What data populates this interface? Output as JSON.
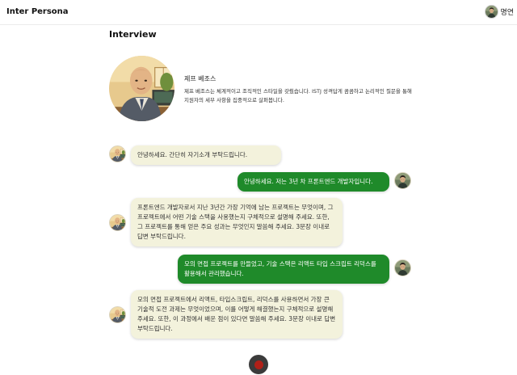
{
  "app": {
    "title": "Inter Persona"
  },
  "user": {
    "name": "명연"
  },
  "page": {
    "title": "Interview"
  },
  "persona": {
    "name": "제프 베조스",
    "description": "제프 베조스는 체계적이고 조직적인 스타일을 갖췄습니다. ISTJ 성격답게 꼼꼼하고 논리적인 질문을 통해 지원자의 세부 사항을 집중적으로 살펴봅니다."
  },
  "messages": [
    {
      "role": "interviewer",
      "text": "안녕하세요. 간단히 자기소개 부탁드립니다."
    },
    {
      "role": "user",
      "text": "안녕하세요. 저는 3년 차 프론트엔드 개발자입니다."
    },
    {
      "role": "interviewer",
      "text": "프론트엔드 개발자로서 지난 3년간 가장 기억에 남는 프로젝트는 무엇이며, 그 프로젝트에서 어떤 기술 스택을 사용했는지 구체적으로 설명해 주세요. 또한, 그 프로젝트를 통해 얻은 주요 성과는 무엇인지 말씀해 주세요. 3문장 이내로 답변 부탁드립니다."
    },
    {
      "role": "user",
      "text": "모의 면접 프로젝트를 만들었고, 기술 스택은 리액트 타입 스크립트 리덕스를 활용해서 관리했습니다."
    },
    {
      "role": "interviewer",
      "text": "모의 면접 프로젝트에서 리액트, 타입스크립트, 리덕스를 사용하면서 가장 큰 기술적 도전 과제는 무엇이었으며, 이를 어떻게 해결했는지 구체적으로 설명해 주세요. 또한, 이 과정에서 배운 점이 있다면 말씀해 주세요. 3문장 이내로 답변 부탁드립니다."
    }
  ],
  "controls": {
    "record_icon": "record-icon"
  },
  "colors": {
    "user_bubble": "#1f8a2a",
    "bot_bubble": "#f3f2dc",
    "record": "#b02018"
  }
}
